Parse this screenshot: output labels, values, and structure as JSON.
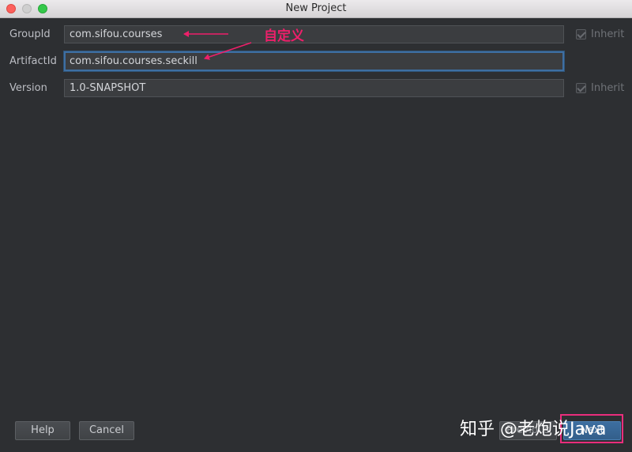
{
  "window": {
    "title": "New Project"
  },
  "fields": {
    "group_id": {
      "label": "GroupId",
      "value": "com.sifou.courses",
      "inherit_label": "Inherit",
      "inherit_checked": true
    },
    "artifact_id": {
      "label": "ArtifactId",
      "value": "com.sifou.courses.seckill"
    },
    "version": {
      "label": "Version",
      "value": "1.0-SNAPSHOT",
      "inherit_label": "Inherit",
      "inherit_checked": true
    }
  },
  "annotation": {
    "text": "自定义",
    "color": "#ee1f6a"
  },
  "buttons": {
    "help": "Help",
    "cancel": "Cancel",
    "previous": "Previous",
    "next": "Next"
  },
  "watermark": {
    "text": "知乎 @老炮说Java"
  },
  "colors": {
    "background": "#2d2f32",
    "input_background": "#3b3d40",
    "focus_border": "#3e6fa3",
    "next_button": "#3d6ea0",
    "highlight_border": "#ea2d7c"
  }
}
